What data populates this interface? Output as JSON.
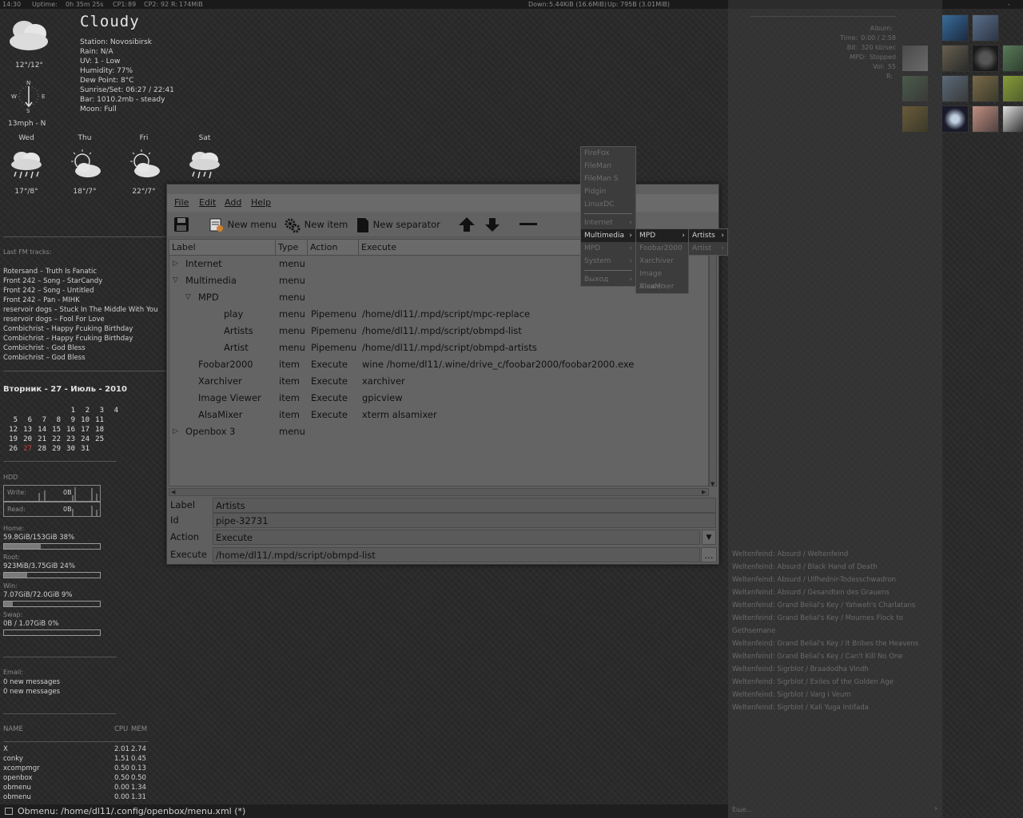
{
  "topbar": {
    "time": "14:30",
    "uptime_label": "Uptime:",
    "uptime": "0h 35m 25s",
    "cpu1_label": "CP1:",
    "cpu1": "89",
    "cpu2_label": "CP2:",
    "cpu2": "92",
    "ram_label": "R:",
    "ram": "174MiB",
    "down_label": "Down:",
    "down": "5.44KiB (16.6MiB)",
    "up_label": "Up:",
    "up": "795B  (3.01MiB)",
    "dash": "-"
  },
  "weather": {
    "title": "Cloudy",
    "temp": "12°/12°",
    "wind": "13mph - N",
    "details": [
      {
        "k": "Station:",
        "v": "Novosibirsk"
      },
      {
        "k": "Rain:",
        "v": "N/A"
      },
      {
        "k": "UV:",
        "v": "1 - Low"
      },
      {
        "k": "Humidity:",
        "v": "77%"
      },
      {
        "k": "Dew Point:",
        "v": "8°C"
      },
      {
        "k": "Sunrise/Set:",
        "v": "06:27 / 22:41"
      },
      {
        "k": "Bar:",
        "v": "1010.2mb - steady"
      },
      {
        "k": "Moon:",
        "v": "Full"
      }
    ],
    "forecast": [
      {
        "day": "Wed",
        "temp": "17°/8°",
        "icon": "rain-icon"
      },
      {
        "day": "Thu",
        "temp": "18°/7°",
        "icon": "sun-cloud-icon"
      },
      {
        "day": "Fri",
        "temp": "22°/7°",
        "icon": "sun-cloud-icon"
      },
      {
        "day": "Sat",
        "temp": "",
        "icon": "rain-icon"
      }
    ]
  },
  "lastfm": {
    "title": "Last FM tracks:",
    "tracks": [
      "Rotersand – Truth Is Fanatic",
      "Front 242 – Song - StarCandy",
      "Front 242 – Song - Untitled",
      "Front 242 – Pan - MIHK",
      "reservoir dogs – Stuck In The Middle With You",
      "reservoir dogs – Fool For Love",
      "Combichrist – Happy Fcuking Birthday",
      "Combichrist – Happy Fcuking Birthday",
      "Combichrist – God Bless",
      "Combichrist – God Bless"
    ]
  },
  "calendar": {
    "title": "Вторник - 27 - Июль - 2010",
    "weeks": [
      [
        "",
        "",
        "",
        "",
        "1",
        "2",
        "3",
        "4"
      ],
      [
        "5",
        "6",
        "7",
        "8",
        "9",
        "10",
        "11"
      ],
      [
        "12",
        "13",
        "14",
        "15",
        "16",
        "17",
        "18"
      ],
      [
        "19",
        "20",
        "21",
        "22",
        "23",
        "24",
        "25"
      ],
      [
        "26",
        "27",
        "28",
        "29",
        "30",
        "31",
        ""
      ]
    ],
    "today": "27"
  },
  "hdd": {
    "title": "HDD",
    "write_label": "Write:",
    "write": "0B",
    "read_label": "Read:",
    "read": "0B"
  },
  "disks": [
    {
      "name": "Home:",
      "usage": "59.8GiB/153GiB   38%",
      "fraction": 0.38
    },
    {
      "name": "Root:",
      "usage": "923MiB/3.75GiB   24%",
      "fraction": 0.24
    },
    {
      "name": "Win:",
      "usage": "7.07GiB/72.0GiB   9%",
      "fraction": 0.09
    },
    {
      "name": "Swap:",
      "usage": "0B  / 1.07GiB  0%",
      "fraction": 0.0
    }
  ],
  "email": {
    "title": "Email:",
    "lines": [
      "0 new messages",
      "0 new messages"
    ]
  },
  "procs": {
    "headers": [
      "NAME",
      "CPU",
      "MEM"
    ],
    "rows": [
      [
        "X",
        "2.01",
        "2.74"
      ],
      [
        "conky",
        "1.51",
        "0.45"
      ],
      [
        "xcompmgr",
        "0.50",
        "0.13"
      ],
      [
        "openbox",
        "0.50",
        "0.50"
      ],
      [
        "obmenu",
        "0.00",
        "1.34"
      ],
      [
        "obmenu",
        "0.00",
        "1.31"
      ]
    ]
  },
  "obmenu": {
    "menus": [
      "File",
      "Edit",
      "Add",
      "Help"
    ],
    "toolbar": {
      "new_menu": "New menu",
      "new_item": "New item",
      "new_separator": "New separator"
    },
    "columns": [
      "Label",
      "Type",
      "Action",
      "Execute"
    ],
    "rows": [
      {
        "tri": "▷",
        "label": "Internet",
        "type": "menu",
        "action": "",
        "execute": "",
        "indent": 0
      },
      {
        "tri": "▽",
        "label": "Multimedia",
        "type": "menu",
        "action": "",
        "execute": "",
        "indent": 0
      },
      {
        "tri": "▽",
        "label": "MPD",
        "type": "menu",
        "action": "",
        "execute": "",
        "indent": 1
      },
      {
        "tri": "",
        "label": "play",
        "type": "menu",
        "action": "Pipemenu",
        "execute": "/home/dl11/.mpd/script/mpc-replace",
        "indent": 2
      },
      {
        "tri": "",
        "label": "Artists",
        "type": "menu",
        "action": "Pipemenu",
        "execute": "/home/dl11/.mpd/script/obmpd-list",
        "indent": 2
      },
      {
        "tri": "",
        "label": "Artist",
        "type": "menu",
        "action": "Pipemenu",
        "execute": "/home/dl11/.mpd/script/obmpd-artists",
        "indent": 2
      },
      {
        "tri": "",
        "label": "Foobar2000",
        "type": "item",
        "action": "Execute",
        "execute": "wine /home/dl11/.wine/drive_c/foobar2000/foobar2000.exe",
        "indent": 1
      },
      {
        "tri": "",
        "label": "Xarchiver",
        "type": "item",
        "action": "Execute",
        "execute": "xarchiver",
        "indent": 1
      },
      {
        "tri": "",
        "label": "Image Viewer",
        "type": "item",
        "action": "Execute",
        "execute": "gpicview",
        "indent": 1
      },
      {
        "tri": "",
        "label": "AlsaMixer",
        "type": "item",
        "action": "Execute",
        "execute": "xterm alsamixer",
        "indent": 1
      },
      {
        "tri": "▷",
        "label": "Openbox 3",
        "type": "menu",
        "action": "",
        "execute": "",
        "indent": 0
      }
    ],
    "props": {
      "label_k": "Label",
      "label_v": "Artists",
      "id_k": "Id",
      "id_v": "pipe-32731",
      "action_k": "Action",
      "action_v": "Execute",
      "execute_k": "Execute",
      "execute_v": "/home/dl11/.mpd/script/obmpd-list",
      "browse": "..."
    }
  },
  "ctxmenu": {
    "main": [
      {
        "label": "FireFox",
        "arrow": ""
      },
      {
        "label": "FileMan",
        "arrow": ""
      },
      {
        "label": "FileMan S",
        "arrow": ""
      },
      {
        "label": "Pidgin",
        "arrow": ""
      },
      {
        "label": "LinuxDC",
        "arrow": ""
      },
      {
        "label": "Internet",
        "arrow": "›"
      },
      {
        "label": "Multimedia",
        "arrow": "›"
      },
      {
        "label": "MPD",
        "arrow": "›"
      },
      {
        "label": "System",
        "arrow": "›"
      },
      {
        "label": "Выход",
        "arrow": "›"
      }
    ],
    "sub1": [
      {
        "label": "MPD",
        "arrow": "›"
      },
      {
        "label": "Foobar2000",
        "arrow": ""
      },
      {
        "label": "Xarchiver",
        "arrow": ""
      },
      {
        "label": "Image Viewer",
        "arrow": ""
      },
      {
        "label": "AlsaMixer",
        "arrow": ""
      }
    ],
    "sub2": [
      {
        "label": "Artists",
        "arrow": "›"
      },
      {
        "label": "Artist",
        "arrow": "›"
      }
    ]
  },
  "mpd_info": [
    {
      "k": "Album:",
      "v": ""
    },
    {
      "k": "Time:",
      "v": "0:00 / 2:58"
    },
    {
      "k": "Bit:",
      "v": "320 kb/sec"
    },
    {
      "k": "MPD:",
      "v": "Stopped"
    },
    {
      "k": "Vol:",
      "v": "55"
    },
    {
      "k": "R:",
      "v": ""
    }
  ],
  "playlist": [
    "Weltenfeind: Absurd / Weltenfeind",
    "Weltenfeind: Absurd / Black Hand of Death",
    "Weltenfeind: Absurd / Ulfhednir-Todesschwadron",
    "Weltenfeind: Absurd / Gesandten des Grauens",
    "Weltenfeind: Grand Belial's Key / Yahweh's Charlatans",
    "Weltenfeind: Grand Belial's Key / Mournes Flock to Gethsemane",
    "Weltenfeind: Grand Belial's Key / It Bribes the Heavens",
    "Weltenfeind: Grand Belial's Key / Can't Kill No One",
    "Weltenfeind: Sigrblot / Braadodha Vindh",
    "Weltenfeind: Sigrblot / Exiles of the Golden Age",
    "Weltenfeind: Sigrblot / Varg I Veum",
    "Weltenfeind: Sigrblot / Kali Yuga Intifada"
  ],
  "more": {
    "label": "Еще...",
    "arrow": "›"
  },
  "status": {
    "text": "Obmenu: /home/dl11/.config/openbox/menu.xml (*)"
  }
}
